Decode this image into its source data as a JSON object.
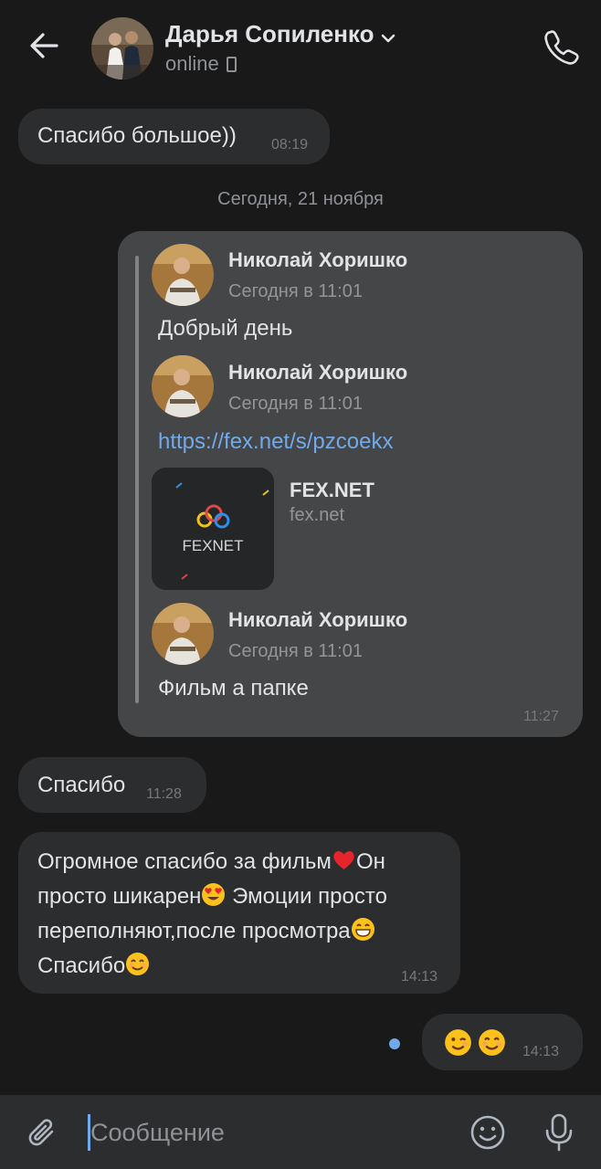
{
  "header": {
    "contact_name": "Дарья Сопиленко",
    "status": "online"
  },
  "messages": [
    {
      "text": "Спасибо большое))",
      "time": "08:19"
    }
  ],
  "date_separator": "Сегодня, 21 ноября",
  "forwarded": {
    "time": "11:27",
    "items": [
      {
        "author": "Николай Хоришко",
        "date": "Сегодня в 11:01",
        "text": "Добрый день"
      },
      {
        "author": "Николай Хоришко",
        "date": "Сегодня в 11:01",
        "link": "https://fex.net/s/pzcoekx",
        "preview": {
          "title": "FEX.NET",
          "domain": "fex.net",
          "logo_text": "FEXNET"
        }
      },
      {
        "author": "Николай Хоришко",
        "date": "Сегодня в 11:01",
        "text": "Фильм а папке"
      }
    ]
  },
  "incoming": [
    {
      "text": "Спасибо",
      "time": "11:28"
    },
    {
      "lines": [
        "Огромное спасибо за фильм",
        "Он",
        "просто шикарен",
        "Эмоции просто",
        "переполняют,после просмотра",
        "Спасибо"
      ],
      "time": "14:13",
      "emojis": [
        "red-heart",
        "heart-eyes",
        "grinning",
        "smiling"
      ]
    }
  ],
  "outgoing": [
    {
      "emojis": [
        "winking",
        "smiling"
      ],
      "time": "14:13"
    }
  ],
  "composer": {
    "placeholder": "Сообщение"
  },
  "colors": {
    "background": "#19191a",
    "bubble_in": "#2c2d2e",
    "bubble_forward": "#454647",
    "accent": "#71aaeb"
  }
}
